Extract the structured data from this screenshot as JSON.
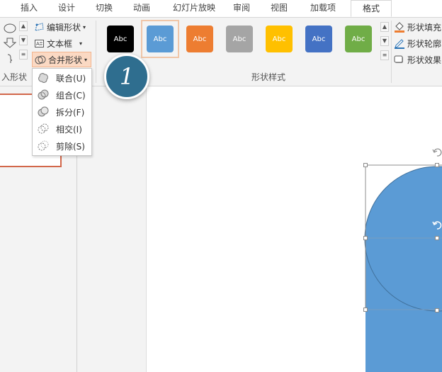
{
  "tabs": [
    {
      "label": "插入",
      "active": false
    },
    {
      "label": "设计",
      "active": false
    },
    {
      "label": "切换",
      "active": false
    },
    {
      "label": "动画",
      "active": false
    },
    {
      "label": "幻灯片放映",
      "active": false
    },
    {
      "label": "审阅",
      "active": false
    },
    {
      "label": "视图",
      "active": false
    },
    {
      "label": "加载项",
      "active": false
    },
    {
      "label": "格式",
      "active": true
    }
  ],
  "insert_shapes_group": {
    "label": "入形状",
    "edit_shape": "编辑形状",
    "text_box": "文本框",
    "merge_shapes": "合并形状"
  },
  "shape_styles": {
    "group_label": "形状样式",
    "swatches": [
      {
        "text": "Abc",
        "fill": "#000000",
        "text_color": "#ffffff"
      },
      {
        "text": "Abc",
        "fill": "#5b9bd5",
        "text_color": "#ffffff",
        "selected": true
      },
      {
        "text": "Abc",
        "fill": "#ed7d31",
        "text_color": "#ffffff"
      },
      {
        "text": "Abc",
        "fill": "#a5a5a5",
        "text_color": "#ffffff"
      },
      {
        "text": "Abc",
        "fill": "#ffc000",
        "text_color": "#ffffff"
      },
      {
        "text": "Abc",
        "fill": "#4472c4",
        "text_color": "#ffffff"
      },
      {
        "text": "Abc",
        "fill": "#70ad47",
        "text_color": "#ffffff"
      }
    ],
    "shape_fill": "形状填充",
    "shape_outline": "形状轮廓",
    "shape_effects": "形状效果"
  },
  "merge_menu": {
    "items": [
      {
        "label": "联合(U)"
      },
      {
        "label": "组合(C)"
      },
      {
        "label": "拆分(F)"
      },
      {
        "label": "相交(I)"
      },
      {
        "label": "剪除(S)"
      }
    ]
  },
  "step_badge": "1",
  "colors": {
    "accent": "#5b9bd5",
    "badge": "#2f6e8f",
    "menu_highlight": "#fbd9c3",
    "thumb_border": "#d2674a"
  }
}
